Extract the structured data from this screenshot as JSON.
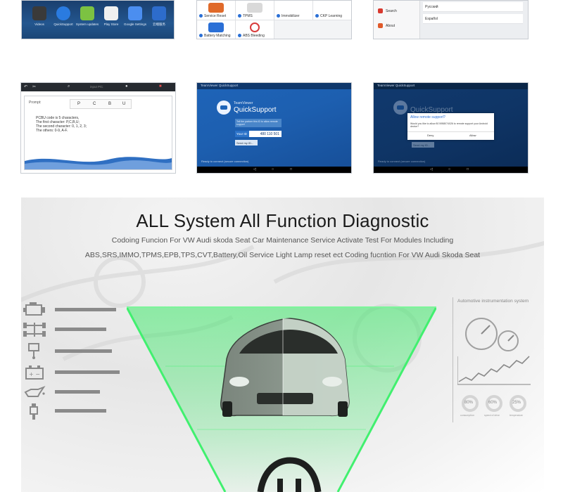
{
  "top_row": {
    "home_apps": [
      {
        "label": "Videos",
        "color": "#3a3a3a"
      },
      {
        "label": "QuickSupport",
        "color": "#2a7be0"
      },
      {
        "label": "System updates",
        "color": "#7cc242"
      },
      {
        "label": "Play Store",
        "color": "#f0f0f0"
      },
      {
        "label": "Google Settings",
        "color": "#4b8ef0"
      },
      {
        "label": "云端服务",
        "color": "#2d6ccc"
      }
    ],
    "function_cells": [
      {
        "label": "Service Reset",
        "color": "#e06a2a"
      },
      {
        "label": "TPMS",
        "color": "#d9d9d9"
      },
      {
        "label": "Immobilizer",
        "color": "#ffffff"
      },
      {
        "label": "CKP Learning",
        "color": "#ffffff"
      },
      {
        "label": "Battery Matching",
        "color": "#2a6fd6"
      },
      {
        "label": "ABS Bleeding",
        "color": "#d83b3b"
      }
    ],
    "settings_items": [
      "Search",
      "About"
    ],
    "languages": [
      "Русский",
      "Español"
    ]
  },
  "middle_row": {
    "code_screen": {
      "search_hint": "input P/C",
      "prompt_label": "Prompt:",
      "letters": [
        "P",
        "C",
        "B",
        "U"
      ],
      "lines": [
        "PCBU code is 5 characters,",
        "The first character: P,C,B,U;",
        "The second character: 0, 1, 2, 3;",
        "The others: 0-9, A-F."
      ]
    },
    "quicksupport": {
      "header": "TeamViewer QuickSupport",
      "brand_small": "TeamViewer",
      "brand_large": "QuickSupport",
      "info_text": "Tell the partner this ID to allow remote support",
      "id_label": "Your ID",
      "id_value": "480 110 501",
      "button_label": "Send my ID...",
      "status": "Ready to connect (secure connection)"
    },
    "quicksupport_dialog": {
      "title": "Allow remote support?",
      "message": "Would you like to allow 80 5958074026 to remote support your Android device?",
      "deny": "Deny",
      "allow": "Allow"
    }
  },
  "banner": {
    "title": "ALL System All Function Diagnostic",
    "subtitle1": "Codoing Funcion For VW Audi skoda Seat Car Maintenance Service Activate Test For Modules Including",
    "subtitle2": "ABS,SRS,IMMO,TPMS,EPB,TPS,CVT,Battery,Oil Service Light Lamp reset ect Coding fucntion For VW Audi Skoda Seat",
    "instrument_label": "Automotive instrumentation system",
    "gauge_values": [
      "80%",
      "60%",
      "25%"
    ],
    "gauge_captions": [
      "consumption",
      "speed of drive",
      "temperature"
    ],
    "system_icons": [
      {
        "icon": "engine-icon",
        "fraction": 0.62
      },
      {
        "icon": "chassis-icon",
        "fraction": 0.52
      },
      {
        "icon": "piston-icon",
        "fraction": 0.58
      },
      {
        "icon": "battery-icon",
        "fraction": 0.66
      },
      {
        "icon": "oil-can-icon",
        "fraction": 0.46
      },
      {
        "icon": "spark-plug-icon",
        "fraction": 0.52
      }
    ],
    "colors": {
      "beam": "#3ee86a",
      "accent": "#2a6fd6"
    }
  }
}
